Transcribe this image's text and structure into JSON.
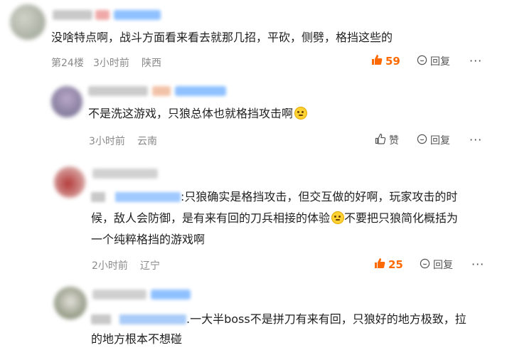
{
  "comments": [
    {
      "text": "没啥特点啊，战斗方面看来看去就那几招，平砍，侧劈，格挡这些的",
      "floor": "第24楼",
      "time": "3小时前",
      "location": "陕西",
      "likes": "59",
      "reply_label": "回复",
      "more_label": "···"
    },
    {
      "text": "不是洗这游戏，只狼总体也就格挡攻击啊",
      "time": "3小时前",
      "location": "云南",
      "like_label": "赞",
      "reply_label": "回复",
      "more_label": "···"
    },
    {
      "line1": ":只狼确实是格挡攻击，但交互做的好啊，玩家攻击的时",
      "line2a": "候，敌人会防御，是有来有回的刀兵相接的体验",
      "line2b": "不要把只狼简化概括为",
      "line3": "一个纯粹格挡的游戏啊",
      "time": "2小时前",
      "location": "辽宁",
      "likes": "25",
      "reply_label": "回复",
      "more_label": "···"
    },
    {
      "line1": ".一大半boss不是拼刀有来有回，只狼好的地方极致，拉",
      "line2": "的地方根本不想碰"
    }
  ],
  "colors": {
    "hot": "#ff6a00",
    "meta": "#8a8a8a",
    "blur_blue": "#8fc1ff"
  }
}
